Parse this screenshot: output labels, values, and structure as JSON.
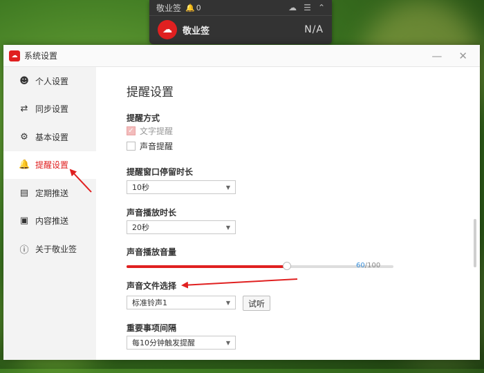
{
  "widget": {
    "title": "敬业签",
    "bell_count": "0",
    "name": "敬业签",
    "value": "N/A"
  },
  "window": {
    "title": "系统设置",
    "minimize_icon": "minimize-icon",
    "close_icon": "close-icon"
  },
  "sidebar": {
    "items": [
      {
        "label": "个人设置",
        "icon": "user-icon"
      },
      {
        "label": "同步设置",
        "icon": "sync-icon"
      },
      {
        "label": "基本设置",
        "icon": "gear-icon"
      },
      {
        "label": "提醒设置",
        "icon": "bell-icon"
      },
      {
        "label": "定期推送",
        "icon": "calendar-icon"
      },
      {
        "label": "内容推送",
        "icon": "document-icon"
      },
      {
        "label": "关于敬业签",
        "icon": "info-icon"
      }
    ],
    "active_index": 3
  },
  "content": {
    "page_title": "提醒设置",
    "reminder_method": {
      "label": "提醒方式",
      "options": [
        {
          "label": "文字提醒",
          "checked": true,
          "disabled": true
        },
        {
          "label": "声音提醒",
          "checked": false,
          "disabled": false
        }
      ]
    },
    "popup_duration": {
      "label": "提醒窗口停留时长",
      "value": "10秒"
    },
    "sound_duration": {
      "label": "声音播放时长",
      "value": "20秒"
    },
    "volume": {
      "label": "声音播放音量",
      "value": 60,
      "max": 100,
      "value_text": "60",
      "max_text": "/100"
    },
    "sound_file": {
      "label": "声音文件选择",
      "value": "标准铃声1",
      "try_button": "试听"
    },
    "important_interval": {
      "label": "重要事项间隔",
      "value": "每10分钟触发提醒"
    }
  },
  "colors": {
    "accent": "#e02020",
    "volume_text": "#3a8fd9"
  }
}
